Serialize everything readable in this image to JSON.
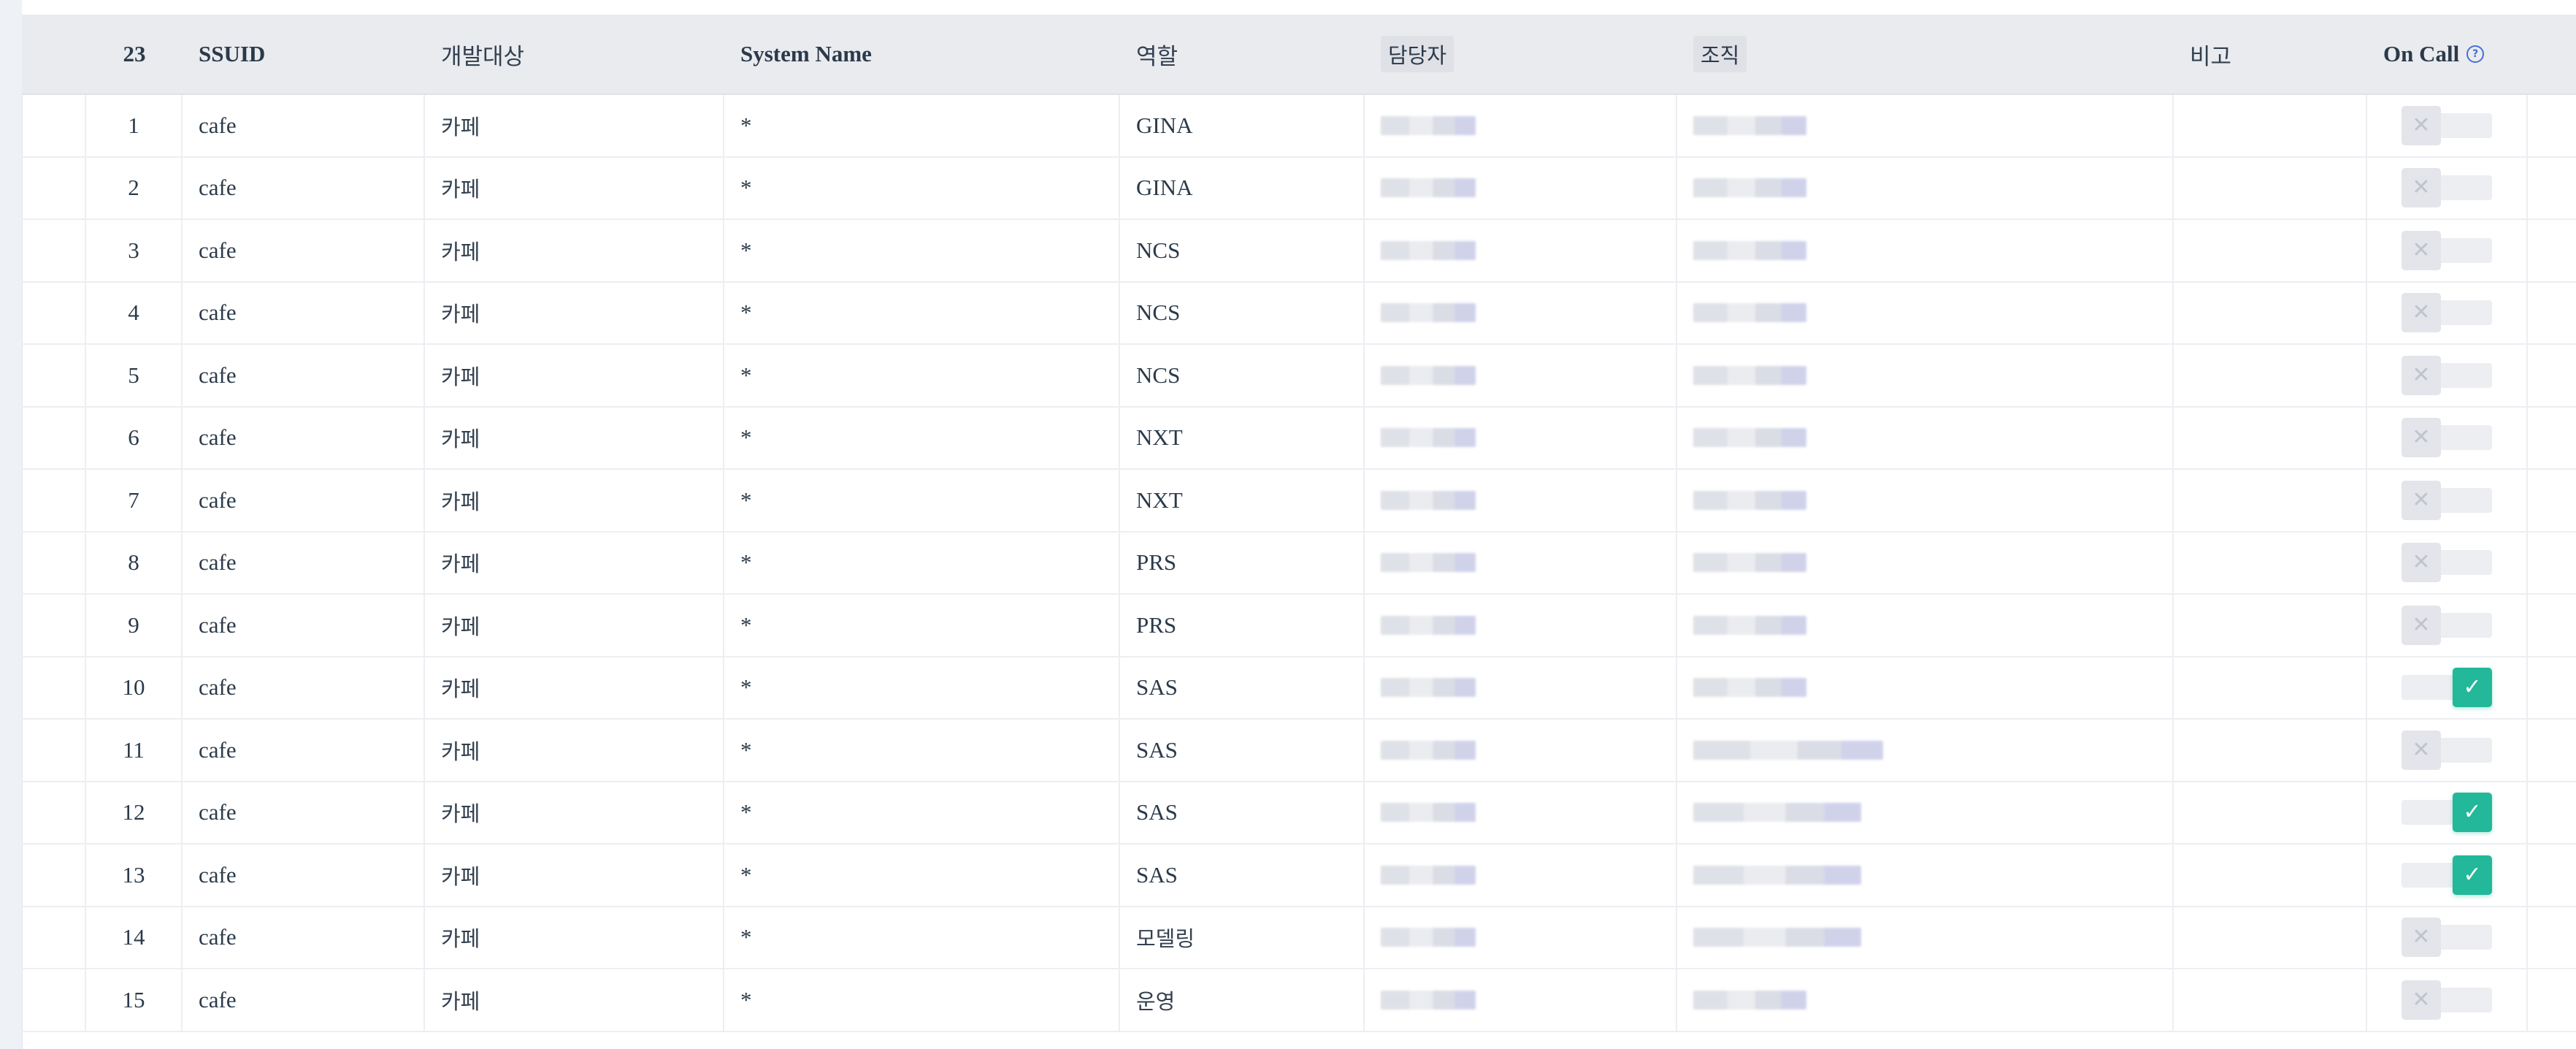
{
  "table": {
    "headers": {
      "count": "23",
      "ssuid": "SSUID",
      "dev_target": "개발대상",
      "system_name": "System Name",
      "role": "역할",
      "owner": "담당자",
      "org": "조직",
      "note": "비고",
      "on_call": "On Call",
      "help_glyph": "?"
    },
    "rows": [
      {
        "no": "1",
        "ssuid": "cafe",
        "target": "카페",
        "system": "*",
        "role": "GINA",
        "on_call": false
      },
      {
        "no": "2",
        "ssuid": "cafe",
        "target": "카페",
        "system": "*",
        "role": "GINA",
        "on_call": false
      },
      {
        "no": "3",
        "ssuid": "cafe",
        "target": "카페",
        "system": "*",
        "role": "NCS",
        "on_call": false
      },
      {
        "no": "4",
        "ssuid": "cafe",
        "target": "카페",
        "system": "*",
        "role": "NCS",
        "on_call": false
      },
      {
        "no": "5",
        "ssuid": "cafe",
        "target": "카페",
        "system": "*",
        "role": "NCS",
        "on_call": false
      },
      {
        "no": "6",
        "ssuid": "cafe",
        "target": "카페",
        "system": "*",
        "role": "NXT",
        "on_call": false
      },
      {
        "no": "7",
        "ssuid": "cafe",
        "target": "카페",
        "system": "*",
        "role": "NXT",
        "on_call": false
      },
      {
        "no": "8",
        "ssuid": "cafe",
        "target": "카페",
        "system": "*",
        "role": "PRS",
        "on_call": false
      },
      {
        "no": "9",
        "ssuid": "cafe",
        "target": "카페",
        "system": "*",
        "role": "PRS",
        "on_call": false
      },
      {
        "no": "10",
        "ssuid": "cafe",
        "target": "카페",
        "system": "*",
        "role": "SAS",
        "on_call": true
      },
      {
        "no": "11",
        "ssuid": "cafe",
        "target": "카페",
        "system": "*",
        "role": "SAS",
        "on_call": false
      },
      {
        "no": "12",
        "ssuid": "cafe",
        "target": "카페",
        "system": "*",
        "role": "SAS",
        "on_call": true
      },
      {
        "no": "13",
        "ssuid": "cafe",
        "target": "카페",
        "system": "*",
        "role": "SAS",
        "on_call": true
      },
      {
        "no": "14",
        "ssuid": "cafe",
        "target": "카페",
        "system": "*",
        "role": "모델링",
        "on_call": false
      },
      {
        "no": "15",
        "ssuid": "cafe",
        "target": "카페",
        "system": "*",
        "role": "운영",
        "on_call": false
      }
    ],
    "toggle_icons": {
      "off": "✕",
      "on": "✓"
    }
  },
  "colors": {
    "header_bg": "#e9ebef",
    "toggle_on": "#22b899",
    "help_icon": "#4a6fd4"
  }
}
